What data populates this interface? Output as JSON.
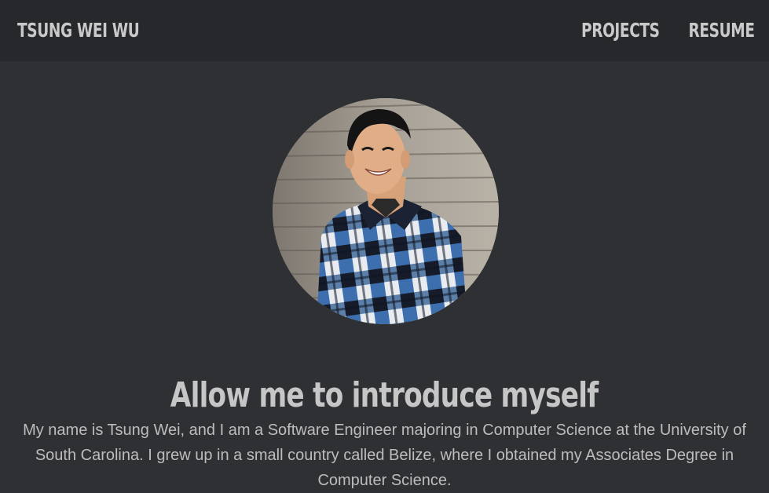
{
  "navbar": {
    "brand": "TSUNG WEI WU",
    "links": [
      {
        "label": "PROJECTS"
      },
      {
        "label": "RESUME"
      }
    ]
  },
  "hero": {
    "avatar_alt": "profile photo",
    "headline": "Allow me to introduce myself",
    "intro": "My name is Tsung Wei, and I am a Software Engineer majoring in Computer Science at the University of South Carolina. I grew up in a small country called Belize, where I obtained my Associates Degree in Computer Science."
  },
  "colors": {
    "background": "#2f3033",
    "navbar": "#27282b",
    "text": "#c6c6c6"
  }
}
